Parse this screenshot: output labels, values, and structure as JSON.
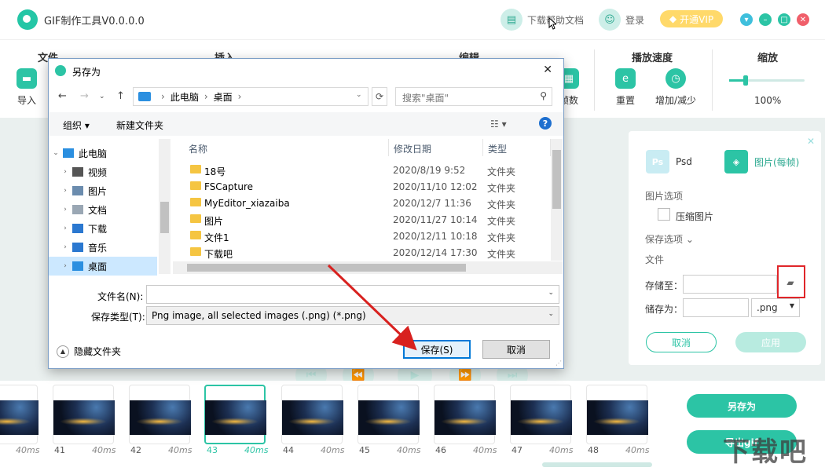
{
  "app": {
    "title": "GIF制作工具V0.0.0.0",
    "header": {
      "help_doc": "下载帮助文档",
      "login": "登录",
      "vip": "开通VIP"
    }
  },
  "ribbon": {
    "groups": {
      "file": "文件",
      "insert": "插入",
      "edit": "编辑",
      "speed": "播放速度",
      "zoom": "缩放"
    },
    "tools": {
      "import": "导入",
      "frames": "帧数",
      "reset": "重置",
      "inc_dec": "增加/减少"
    },
    "zoom_value": "100%",
    "zoom_level": 0.22
  },
  "right_panel": {
    "formats": {
      "psd": "Psd",
      "image": "图片(每帧)"
    },
    "image_options": "图片选项",
    "compress": "压缩图片",
    "save_options": "保存选项",
    "file_section": "文件",
    "save_to": "存储至：",
    "save_as": "储存为：",
    "format_value": ".png",
    "cancel": "取消",
    "apply": "应用"
  },
  "filmstrip": {
    "frames": [
      {
        "num": "",
        "ms": "40ms"
      },
      {
        "num": "41",
        "ms": "40ms"
      },
      {
        "num": "42",
        "ms": "40ms"
      },
      {
        "num": "43",
        "ms": "40ms"
      },
      {
        "num": "44",
        "ms": "40ms"
      },
      {
        "num": "45",
        "ms": "40ms"
      },
      {
        "num": "46",
        "ms": "40ms"
      },
      {
        "num": "47",
        "ms": "40ms"
      },
      {
        "num": "48",
        "ms": "40ms"
      }
    ],
    "selected_frame": "43"
  },
  "actions": {
    "save_as": "另存为",
    "export_gif": "导出gif"
  },
  "watermark": "下载吧",
  "dialog": {
    "title": "另存为",
    "breadcrumb": [
      "此电脑",
      "桌面"
    ],
    "search_placeholder": "搜索\"桌面\"",
    "toolbar": {
      "organize": "组织 ▾",
      "new_folder": "新建文件夹"
    },
    "tree": [
      "此电脑",
      "视频",
      "图片",
      "文档",
      "下载",
      "音乐",
      "桌面"
    ],
    "columns": {
      "name": "名称",
      "modified": "修改日期",
      "type": "类型"
    },
    "files": [
      {
        "name": "18号",
        "date": "2020/8/19 9:52",
        "type": "文件夹"
      },
      {
        "name": "FSCapture",
        "date": "2020/11/10 12:02",
        "type": "文件夹"
      },
      {
        "name": "MyEditor_xiazaiba",
        "date": "2020/12/7 11:36",
        "type": "文件夹"
      },
      {
        "name": "图片",
        "date": "2020/11/27 10:14",
        "type": "文件夹"
      },
      {
        "name": "文件1",
        "date": "2020/12/11 10:18",
        "type": "文件夹"
      },
      {
        "name": "下载吧",
        "date": "2020/12/14 17:30",
        "type": "文件夹"
      }
    ],
    "filename_label": "文件名(N):",
    "filename_value": "",
    "filetype_label": "保存类型(T):",
    "filetype_value": "Png image, all selected images (.png) (*.png)",
    "hide_folders": "隐藏文件夹",
    "save": "保存(S)",
    "cancel": "取消"
  },
  "colors": {
    "accent": "#2cc4a5",
    "highlight": "#e0262a",
    "vip": "#ffd96a"
  }
}
